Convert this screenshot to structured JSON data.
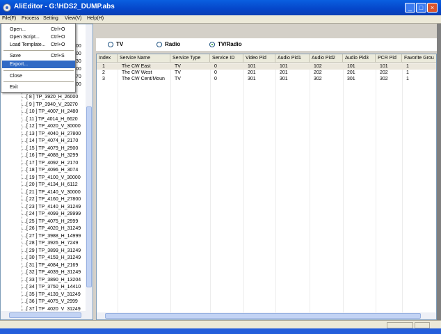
{
  "window": {
    "title": "AliEditor - G:\\HDS2_DUMP.abs"
  },
  "menubar": [
    "File(F)",
    "Process",
    "Setting",
    "View(V)",
    "Help(H)"
  ],
  "file_menu": [
    {
      "label": "Open...",
      "shortcut": "Ctrl+O"
    },
    {
      "label": "Open Script...",
      "shortcut": "Ctrl+O"
    },
    {
      "label": "Load Template...",
      "shortcut": "Ctrl+O"
    },
    {
      "label": "Save",
      "shortcut": "Ctrl+S"
    },
    {
      "label": "Export...",
      "shortcut": ""
    },
    {
      "label": "Close",
      "shortcut": ""
    },
    {
      "label": "Exit",
      "shortcut": ""
    }
  ],
  "tree_partial_top": [
    "00",
    "00",
    "30",
    "00",
    "70",
    "00"
  ],
  "tree": [
    "[ 8 ]  TP_3920_H_26000",
    "[ 9 ]  TP_3940_V_29270",
    "[ 10 ]  TP_4007_H_2480",
    "[ 11 ]  TP_4014_H_6620",
    "[ 12 ]  TP_4020_V_30000",
    "[ 13 ]  TP_4040_H_27800",
    "[ 14 ]  TP_4074_H_2170",
    "[ 15 ]  TP_4079_H_2900",
    "[ 16 ]  TP_4088_H_3299",
    "[ 17 ]  TP_4092_H_2170",
    "[ 18 ]  TP_4096_H_3074",
    "[ 19 ]  TP_4100_V_30000",
    "[ 20 ]  TP_4134_H_6112",
    "[ 21 ]  TP_4140_V_30000",
    "[ 22 ]  TP_4160_H_27800",
    "[ 23 ]  TP_4140_H_31249",
    "[ 24 ]  TP_4099_H_29999",
    "[ 25 ]  TP_4075_H_2999",
    "[ 26 ]  TP_4020_H_31249",
    "[ 27 ]  TP_3988_H_14999",
    "[ 28 ]  TP_3926_H_7249",
    "[ 29 ]  TP_3899_H_31249",
    "[ 30 ]  TP_4159_H_31249",
    "[ 31 ]  TP_4084_H_2169",
    "[ 32 ]  TP_4039_H_31249",
    "[ 33 ]  TP_3890_H_13204",
    "[ 34 ]  TP_3750_H_14410",
    "[ 35 ]  TP_4139_V_31249",
    "[ 36 ]  TP_4075_V_2999",
    "[ 37 ]  TP_4020_V_31249"
  ],
  "radios": [
    {
      "label": "TV",
      "checked": false
    },
    {
      "label": "Radio",
      "checked": false
    },
    {
      "label": "TV/Radio",
      "checked": true
    }
  ],
  "columns": [
    "Index",
    "Service Name",
    "Service Type",
    "Service ID",
    "Video Pid",
    "Audio Pid1",
    "Audio Pid2",
    "Audio Pid3",
    "PCR Pid",
    "Favorite Grou"
  ],
  "rows": [
    [
      "1",
      "The CW East",
      "TV",
      "0",
      "101",
      "101",
      "102",
      "101",
      "101",
      "1"
    ],
    [
      "2",
      "The CW West",
      "TV",
      "0",
      "201",
      "201",
      "202",
      "201",
      "202",
      "1"
    ],
    [
      "3",
      "The CW Cent/Moun",
      "TV",
      "0",
      "301",
      "301",
      "302",
      "301",
      "302",
      "1"
    ]
  ]
}
